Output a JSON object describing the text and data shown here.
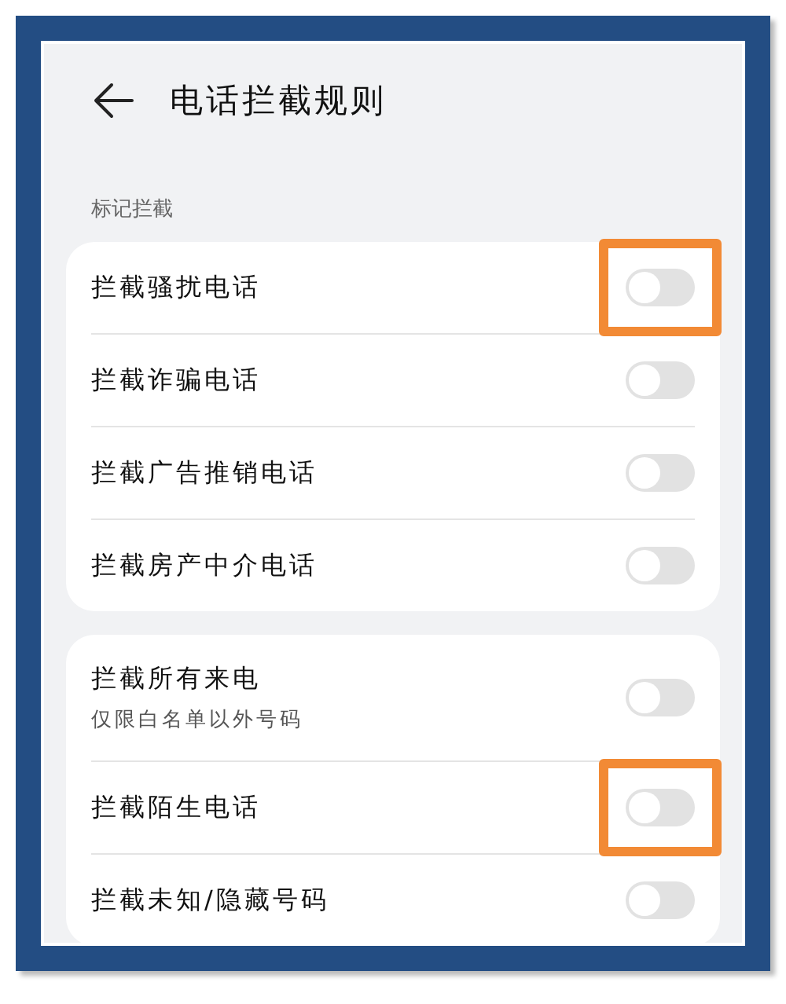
{
  "header": {
    "title": "电话拦截规则"
  },
  "section_label": "标记拦截",
  "groups": [
    {
      "items": [
        {
          "label": "拦截骚扰电话",
          "on": false,
          "highlighted": true
        },
        {
          "label": "拦截诈骗电话",
          "on": false,
          "highlighted": false
        },
        {
          "label": "拦截广告推销电话",
          "on": false,
          "highlighted": false
        },
        {
          "label": "拦截房产中介电话",
          "on": false,
          "highlighted": false
        }
      ]
    },
    {
      "items": [
        {
          "label": "拦截所有来电",
          "subtitle": "仅限白名单以外号码",
          "on": false,
          "highlighted": false
        },
        {
          "label": "拦截陌生电话",
          "on": false,
          "highlighted": true
        },
        {
          "label": "拦截未知/隐藏号码",
          "on": false,
          "highlighted": false
        }
      ]
    }
  ]
}
